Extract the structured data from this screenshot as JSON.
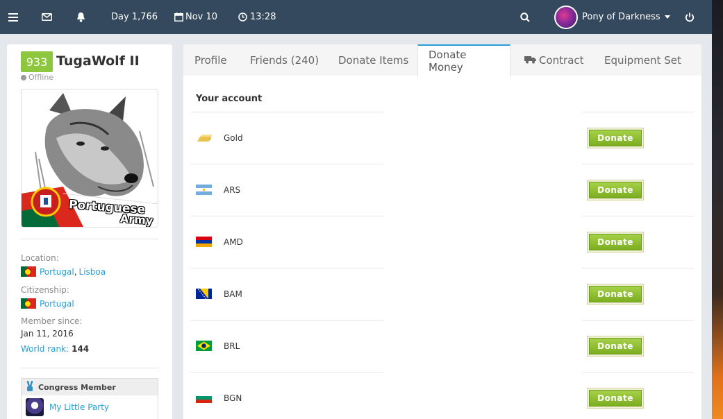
{
  "topbar": {
    "day": "Day 1,766",
    "date": "Nov 10",
    "time": "13:28",
    "user_name": "Pony of Darkness",
    "icons": [
      "menu-icon",
      "envelope-icon",
      "bell-icon",
      "calendar-icon",
      "clock-icon",
      "search-icon",
      "power-icon"
    ]
  },
  "profile": {
    "level": "933",
    "name": "TugaWolf II",
    "status": "Offline",
    "image_text_line1": "Portuguese",
    "image_text_line2": "Army",
    "location_label": "Location:",
    "location_country": "Portugal",
    "location_sep": ",",
    "location_city": "Lisboa",
    "citizenship_label": "Citizenship:",
    "citizenship_country": "Portugal",
    "member_since_label": "Member since:",
    "member_since_value": "Jan 11, 2016",
    "world_rank_label": "World rank:",
    "world_rank_value": "144",
    "congress_label": "Congress Member",
    "party_name": "My Little Party"
  },
  "tabs": [
    "Profile",
    "Friends (240)",
    "Donate Items",
    "Donate Money",
    "Contract",
    "Equipment Set"
  ],
  "active_tab": "Donate Money",
  "account": {
    "heading": "Your account",
    "donate_label": "Donate",
    "currencies": [
      {
        "name": "Gold",
        "icon": "gold-bar-icon"
      },
      {
        "name": "ARS",
        "icon": "flag-argentina-icon"
      },
      {
        "name": "AMD",
        "icon": "flag-armenia-icon"
      },
      {
        "name": "BAM",
        "icon": "flag-bosnia-icon"
      },
      {
        "name": "BRL",
        "icon": "flag-brazil-icon"
      },
      {
        "name": "BGN",
        "icon": "flag-bulgaria-icon"
      }
    ]
  },
  "colors": {
    "topbar": "#34495e",
    "accent": "#2a9fd6",
    "level_badge": "#8dc63f",
    "donate_button": "#8cbf2a"
  }
}
